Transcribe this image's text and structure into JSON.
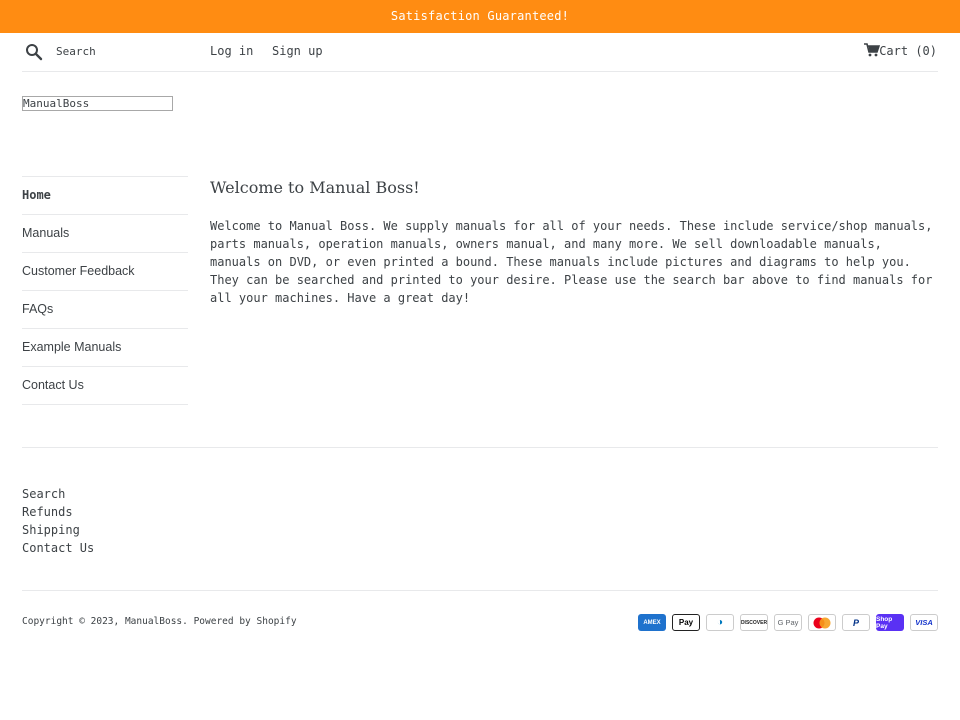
{
  "announcement": {
    "text": "Satisfaction Guaranteed!",
    "bg_color": "#ff8c12"
  },
  "header": {
    "search_icon": "search-icon",
    "search_placeholder": "Search",
    "login_label": "Log in",
    "signup_label": "Sign up",
    "cart_icon": "cart-icon",
    "cart_label": "Cart (0)"
  },
  "logo": {
    "alt_text": "ManualBoss"
  },
  "sidebar": {
    "items": [
      {
        "label": "Home",
        "active": true
      },
      {
        "label": "Manuals",
        "active": false
      },
      {
        "label": "Customer Feedback",
        "active": false
      },
      {
        "label": "FAQs",
        "active": false
      },
      {
        "label": "Example Manuals",
        "active": false
      },
      {
        "label": "Contact Us",
        "active": false
      }
    ]
  },
  "main": {
    "title": "Welcome to Manual Boss!",
    "body": "Welcome to Manual Boss. We supply manuals for all of your needs. These include service/shop manuals, parts manuals, operation manuals, owners manual, and many more. We sell downloadable manuals,  manuals on DVD, or even printed a bound. These manuals include pictures and diagrams to help you. They can be searched and printed to your desire. Please use the search bar above to find manuals for all your machines. Have a great day!"
  },
  "footer": {
    "links": [
      "Search",
      "Refunds",
      "Shipping",
      "Contact Us"
    ],
    "copyright": "Copyright © 2023, ManualBoss. Powered by Shopify",
    "payment_icons": [
      {
        "name": "american-express-icon",
        "label": "AMEX"
      },
      {
        "name": "apple-pay-icon",
        "label": " Pay"
      },
      {
        "name": "diners-club-icon",
        "label": "◑"
      },
      {
        "name": "discover-icon",
        "label": "DISCOVER"
      },
      {
        "name": "google-pay-icon",
        "label": "G Pay"
      },
      {
        "name": "mastercard-icon",
        "label": ""
      },
      {
        "name": "paypal-icon",
        "label": "P"
      },
      {
        "name": "shop-pay-icon",
        "label": "Shop Pay"
      },
      {
        "name": "visa-icon",
        "label": "VISA"
      }
    ]
  }
}
